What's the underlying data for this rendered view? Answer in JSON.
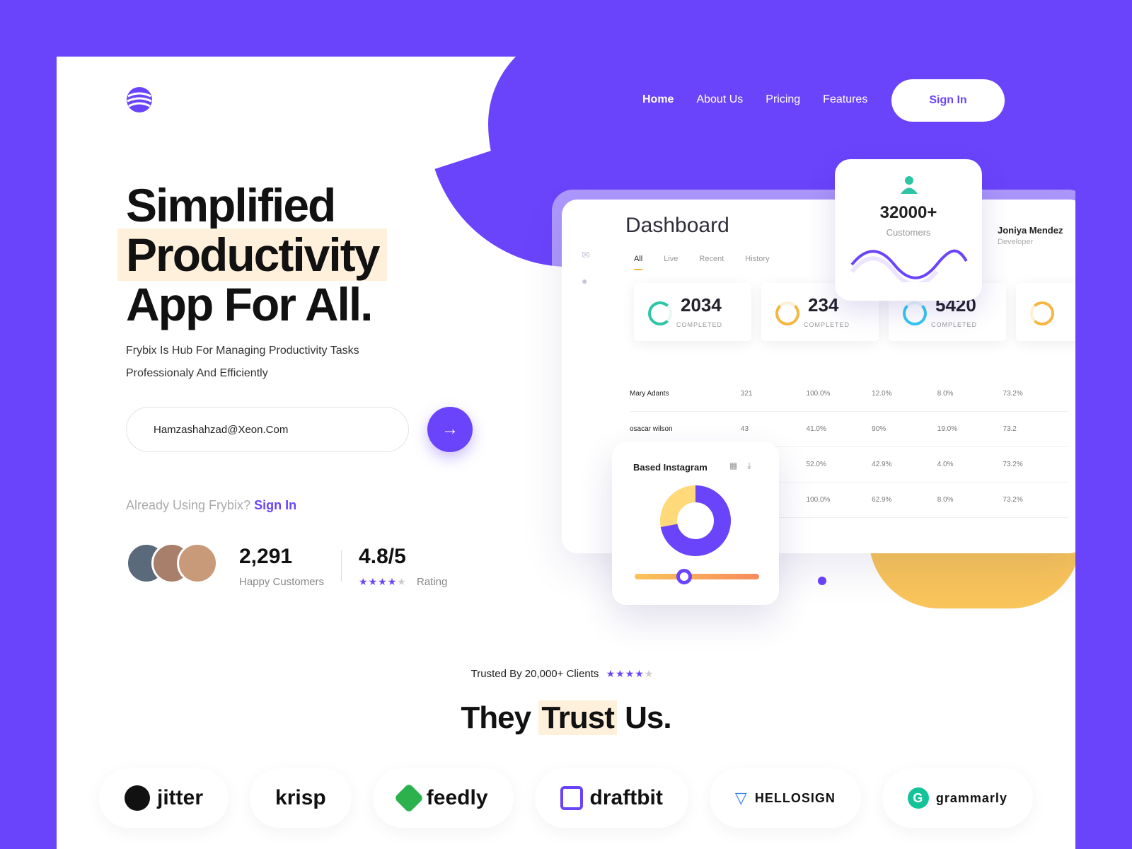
{
  "nav": {
    "items": [
      "Home",
      "About Us",
      "Pricing",
      "Features"
    ],
    "signin_label": "Sign In"
  },
  "hero": {
    "title_line1": "Simplified",
    "title_line2": "Productivity",
    "title_line3": "App For All.",
    "description": "Frybix Is Hub For Managing Productivity Tasks Professionaly And Efficiently",
    "email_value": "Hamzashahzad@Xeon.Com",
    "already_text": "Already Using Frybix?",
    "already_link": "Sign In"
  },
  "stats": {
    "customers_value": "2,291",
    "customers_label": "Happy Customers",
    "rating_value": "4.8/5",
    "rating_stars": 4,
    "rating_label": "Rating"
  },
  "dashboard": {
    "title": "Dashboard",
    "tabs": [
      "All",
      "Live",
      "Recent",
      "History"
    ],
    "cards": [
      {
        "value": "2034",
        "label": "COMPLETED",
        "color": "#2ec4a6"
      },
      {
        "value": "234",
        "label": "COMPLETED",
        "color": "#f5b642"
      },
      {
        "value": "5420",
        "label": "COMPLETED",
        "color": "#35c8ee"
      }
    ],
    "rows": [
      [
        "Mary Adants",
        "321",
        "100.0%",
        "12.0%",
        "8.0%",
        "73.2%"
      ],
      [
        "osacar wilson",
        "43",
        "41.0%",
        "90%",
        "19.0%",
        "73.2"
      ],
      [
        "",
        "",
        "52.0%",
        "42.9%",
        "4.0%",
        "73.2%"
      ],
      [
        "",
        "",
        "100.0%",
        "62.9%",
        "8.0%",
        "73.2%"
      ]
    ],
    "customers_value": "32000+",
    "customers_label": "Customers",
    "user_name": "Joniya Mendez",
    "user_role": "Developer",
    "insta_title": "Based Instagram",
    "donut_share": 0.72,
    "slider_level": 0.4
  },
  "trusted": {
    "text": "Trusted By 20,000+ Clients",
    "stars": 4,
    "title_before": "They",
    "title_highlight": "Trust",
    "title_after": "Us."
  },
  "brands": [
    "jitter",
    "krisp",
    "feedly",
    "draftbit",
    "HELLOSIGN",
    "grammarly"
  ],
  "colors": {
    "accent": "#6a44fb",
    "highlight": "#fff0dc",
    "gold": "#f9c45a"
  }
}
